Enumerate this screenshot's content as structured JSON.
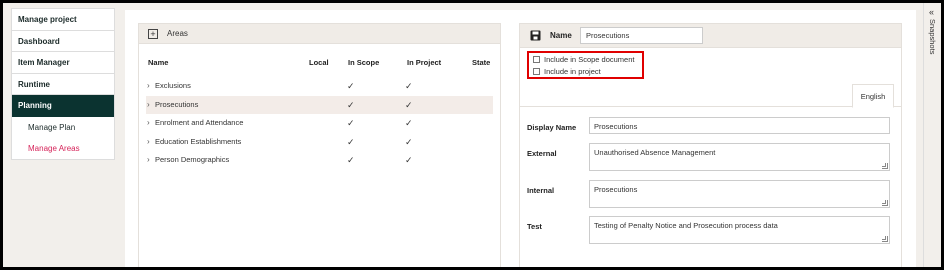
{
  "sidebar": {
    "items": [
      {
        "label": "Manage project"
      },
      {
        "label": "Dashboard"
      },
      {
        "label": "Item Manager"
      },
      {
        "label": "Runtime"
      },
      {
        "label": "Planning"
      }
    ],
    "subitems": [
      {
        "label": "Manage Plan"
      },
      {
        "label": "Manage Areas"
      }
    ]
  },
  "areas_panel": {
    "title": "Areas",
    "columns": {
      "name": "Name",
      "local": "Local",
      "in_scope": "In Scope",
      "in_project": "In Project",
      "state": "State"
    },
    "tick": "✓",
    "rows": [
      {
        "name": "Exclusions"
      },
      {
        "name": "Prosecutions"
      },
      {
        "name": "Enrolment and Attendance"
      },
      {
        "name": "Education Establishments"
      },
      {
        "name": "Person Demographics"
      }
    ]
  },
  "detail_panel": {
    "name_label": "Name",
    "name_value": "Prosecutions",
    "include_scope_label": "Include in Scope document",
    "include_project_label": "Include in project",
    "language_tab": "English",
    "fields": {
      "display_name": {
        "label": "Display Name",
        "value": "Prosecutions"
      },
      "external": {
        "label": "External",
        "value": "Unauthorised Absence Management"
      },
      "internal": {
        "label": "Internal",
        "value": "Prosecutions"
      },
      "test": {
        "label": "Test",
        "value": "Testing of Penalty Notice and Prosecution process data"
      }
    }
  },
  "snapshots": {
    "label": "Snapshots",
    "chevron": "«"
  },
  "colors": {
    "sidebar_active": "#0b3330",
    "current_link": "#d6245a",
    "highlight_border": "#e00000"
  }
}
